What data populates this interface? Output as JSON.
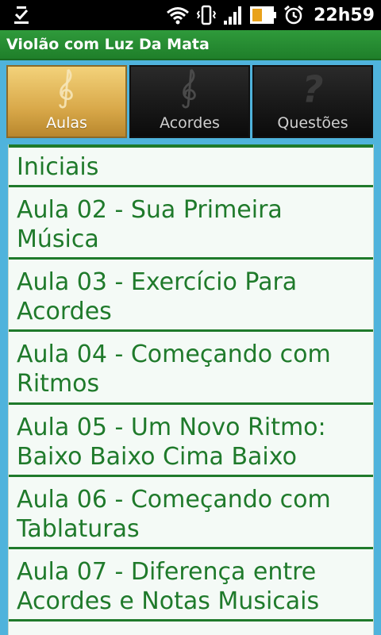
{
  "status_bar": {
    "time": "22h59",
    "icons": [
      "download-done-icon",
      "wifi-icon",
      "vibrate-icon",
      "signal-icon",
      "battery-icon",
      "alarm-icon"
    ]
  },
  "app": {
    "title": "Violão com Luz Da Mata"
  },
  "tabs": [
    {
      "label": "Aulas",
      "icon": "treble-clef-gold-icon",
      "active": true
    },
    {
      "label": "Acordes",
      "icon": "treble-clef-icon",
      "active": false
    },
    {
      "label": "Questões",
      "icon": "question-mark-icon",
      "active": false
    }
  ],
  "lessons": [
    {
      "label": "Iniciais"
    },
    {
      "label": "Aula 02 - Sua Primeira Música"
    },
    {
      "label": "Aula 03 - Exercício Para Acordes"
    },
    {
      "label": "Aula 04 - Começando com Ritmos"
    },
    {
      "label": "Aula 05 - Um Novo Ritmo: Baixo Baixo Cima Baixo"
    },
    {
      "label": "Aula 06 - Começando com Tablaturas"
    },
    {
      "label": "Aula 07 - Diferença entre Acordes e Notas Musicais"
    }
  ],
  "colors": {
    "background": "#4fb3dc",
    "title_bar": "#2f9a3b",
    "list_text": "#1f7a2b",
    "list_bg": "#f4faf6",
    "active_tab": "#d9a94a"
  }
}
